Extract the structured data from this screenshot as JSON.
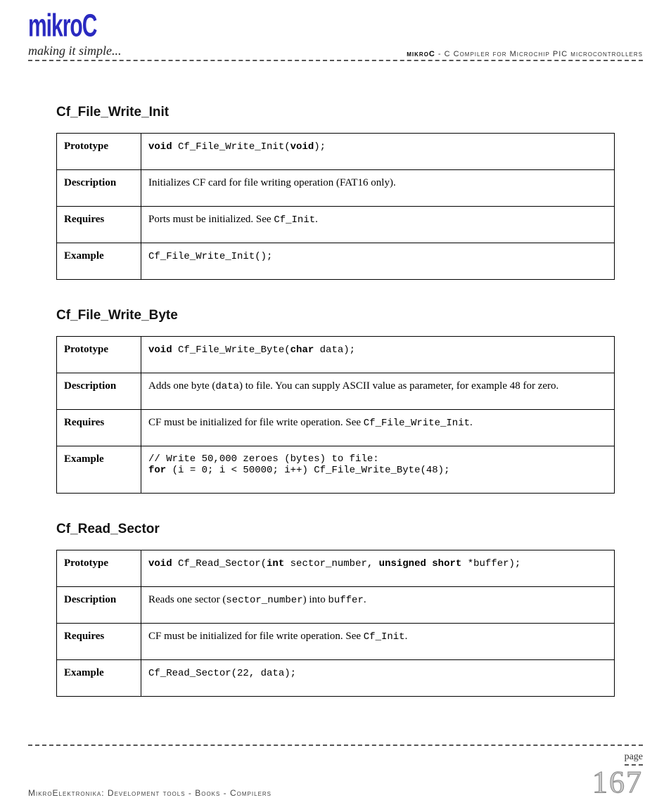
{
  "header": {
    "logo": "mikroC",
    "tagline": "making it simple...",
    "subtitle_brand": "mikroC",
    "subtitle_rest": " - C Compiler for Microchip PIC microcontrollers"
  },
  "functions": [
    {
      "title": "Cf_File_Write_Init",
      "rows": {
        "prototype_pre": "void",
        "prototype_mid": " Cf_File_Write_Init(",
        "prototype_arg": "void",
        "prototype_post": ");",
        "description_pre": "Initializes CF card for file writing operation (FAT16 only).",
        "description_code": "",
        "description_post": "",
        "requires_pre": "Ports must be initialized. See ",
        "requires_code": "Cf_Init",
        "requires_post": ".",
        "example": "Cf_File_Write_Init();"
      }
    },
    {
      "title": "Cf_File_Write_Byte",
      "rows": {
        "prototype_pre": "void",
        "prototype_mid": " Cf_File_Write_Byte(",
        "prototype_arg": "char",
        "prototype_post": " data);",
        "description_pre": "Adds one byte (",
        "description_code": "data",
        "description_post": ") to file. You can supply ASCII value as parameter, for example 48 for zero.",
        "requires_pre": "CF must be initialized for file write operation. See ",
        "requires_code": "Cf_File_Write_Init",
        "requires_post": ".",
        "example_line1": "// Write 50,000 zeroes (bytes) to file:",
        "example_kw": "for",
        "example_rest": " (i = 0; i < 50000; i++) Cf_File_Write_Byte(48);"
      }
    },
    {
      "title": "Cf_Read_Sector",
      "rows": {
        "prototype_pre": "void",
        "prototype_mid": " Cf_Read_Sector(",
        "prototype_arg1": "int",
        "prototype_mid2": " sector_number, ",
        "prototype_arg2": "unsigned short",
        "prototype_post": " *buffer);",
        "description_pre": "Reads one sector (",
        "description_code": "sector_number",
        "description_mid": ") into ",
        "description_code2": "buffer",
        "description_post": ".",
        "requires_pre": "CF must be initialized for file write operation. See ",
        "requires_code": "Cf_Init",
        "requires_post": ".",
        "example": "Cf_Read_Sector(22, data);"
      }
    }
  ],
  "labels": {
    "prototype": "Prototype",
    "description": "Description",
    "requires": "Requires",
    "example": "Example"
  },
  "footer": {
    "left": "MikroElektronika: Development tools - Books - Compilers",
    "page_label": "page",
    "page_number": "167"
  }
}
